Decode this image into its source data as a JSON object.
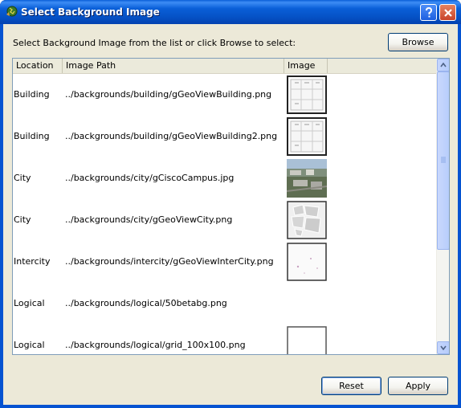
{
  "window": {
    "title": "Select Background Image"
  },
  "instruction": "Select Background Image from the list or click Browse to select:",
  "buttons": {
    "browse": "Browse",
    "reset": "Reset",
    "apply": "Apply"
  },
  "table": {
    "columns": [
      "Location",
      "Image Path",
      "Image"
    ],
    "rows": [
      {
        "location": "Building",
        "path": "../backgrounds/building/gGeoViewBuilding.png",
        "thumb": "floorplan"
      },
      {
        "location": "Building",
        "path": "../backgrounds/building/gGeoViewBuilding2.png",
        "thumb": "floorplan"
      },
      {
        "location": "City",
        "path": "../backgrounds/city/gCiscoCampus.jpg",
        "thumb": "aerial-photo"
      },
      {
        "location": "City",
        "path": "../backgrounds/city/gGeoViewCity.png",
        "thumb": "city-map"
      },
      {
        "location": "Intercity",
        "path": "../backgrounds/intercity/gGeoViewInterCity.png",
        "thumb": "intercity-map"
      },
      {
        "location": "Logical",
        "path": "../backgrounds/logical/50betabg.png",
        "thumb": "none"
      },
      {
        "location": "Logical",
        "path": "../backgrounds/logical/grid_100x100.png",
        "thumb": "grid"
      }
    ]
  },
  "colors": {
    "titlebar": "#0553d1",
    "dialog": "#ece9d8",
    "border": "#7f9db9"
  }
}
